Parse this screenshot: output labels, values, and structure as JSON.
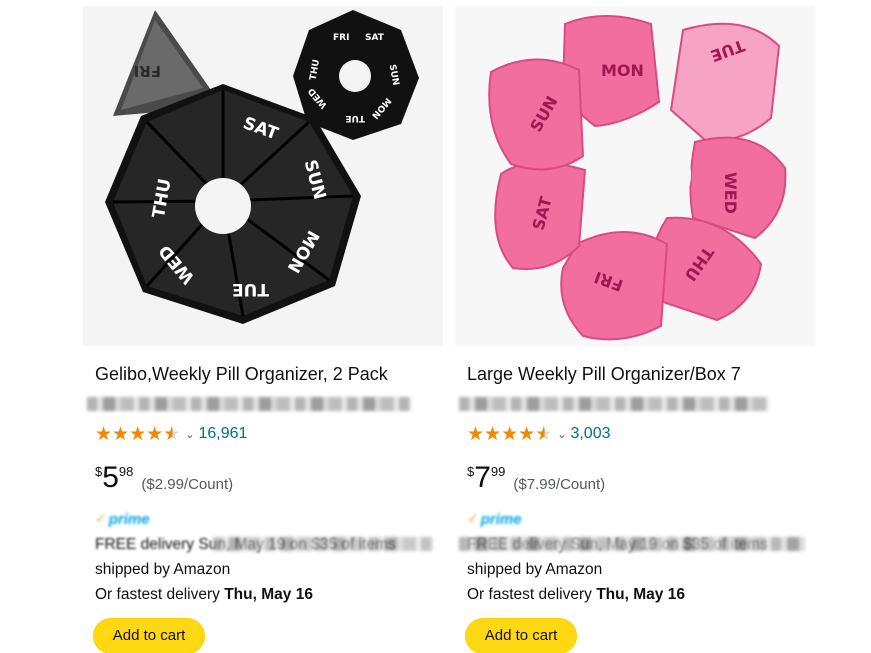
{
  "products": [
    {
      "title": "Gelibo,Weekly Pill Organizer, 2 Pack",
      "rating_value": 4.5,
      "review_count": "16,961",
      "price_currency": "$",
      "price_whole": "5",
      "price_fraction": "98",
      "price_per_unit": "($2.99/Count)",
      "prime_label": "prime",
      "delivery_line1": "FREE delivery Sun, May 19 on $35 of items",
      "delivery_line2": "shipped by Amazon",
      "delivery_line3_prefix": "Or fastest delivery ",
      "delivery_line3_date": "Thu, May 16",
      "add_to_cart_label": "Add to cart",
      "image_days": [
        "FRI",
        "SAT",
        "SUN",
        "MON",
        "TUE",
        "WED",
        "THU"
      ],
      "image_color": "#1f1f1f"
    },
    {
      "title": "Large Weekly Pill Organizer/Box 7",
      "rating_value": 4.5,
      "review_count": "3,003",
      "price_currency": "$",
      "price_whole": "7",
      "price_fraction": "99",
      "price_per_unit": "($7.99/Count)",
      "prime_label": "prime",
      "delivery_line1": "FREE delivery Sun, May 19 on $35 of items",
      "delivery_line2": "shipped by Amazon",
      "delivery_line3_prefix": "Or fastest delivery ",
      "delivery_line3_date": "Thu, May 16",
      "add_to_cart_label": "Add to cart",
      "image_days": [
        "MON",
        "TUE",
        "WED",
        "THU",
        "FRI",
        "SAT",
        "SUN"
      ],
      "image_color": "#f0669a"
    }
  ]
}
